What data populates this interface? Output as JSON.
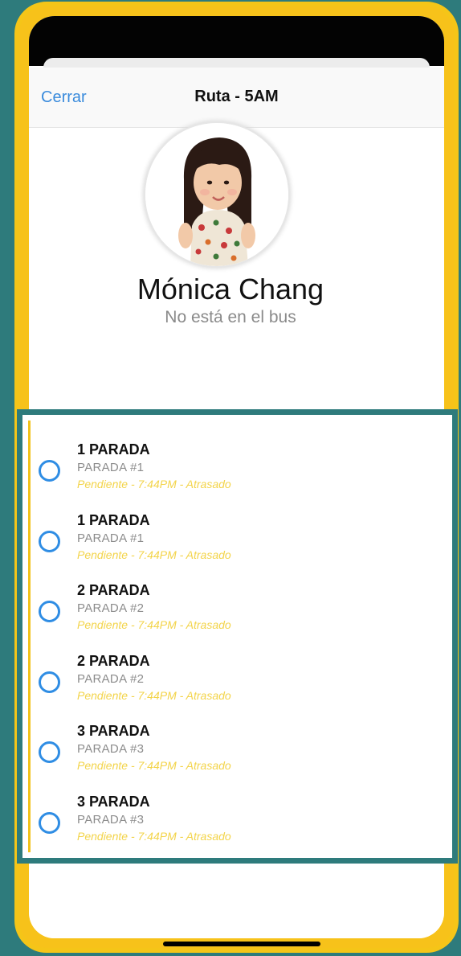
{
  "navbar": {
    "close_label": "Cerrar",
    "title": "Ruta - 5AM"
  },
  "profile": {
    "name": "Mónica Chang",
    "status": "No está en el bus"
  },
  "stops": [
    {
      "title": "1 PARADA",
      "subtitle": "PARADA #1",
      "meta": "Pendiente - 7:44PM - Atrasado"
    },
    {
      "title": "1 PARADA",
      "subtitle": "PARADA #1",
      "meta": "Pendiente - 7:44PM - Atrasado"
    },
    {
      "title": "2 PARADA",
      "subtitle": "PARADA #2",
      "meta": "Pendiente - 7:44PM - Atrasado"
    },
    {
      "title": "2 PARADA",
      "subtitle": "PARADA #2",
      "meta": "Pendiente - 7:44PM - Atrasado"
    },
    {
      "title": "3 PARADA",
      "subtitle": "PARADA #3",
      "meta": "Pendiente - 7:44PM - Atrasado"
    },
    {
      "title": "3 PARADA",
      "subtitle": "PARADA #3",
      "meta": "Pendiente - 7:44PM - Atrasado"
    }
  ],
  "colors": {
    "background": "#2e7b7c",
    "frame": "#f5c518",
    "accent_blue": "#2f8de4",
    "status_yellow": "#f3d44a"
  }
}
